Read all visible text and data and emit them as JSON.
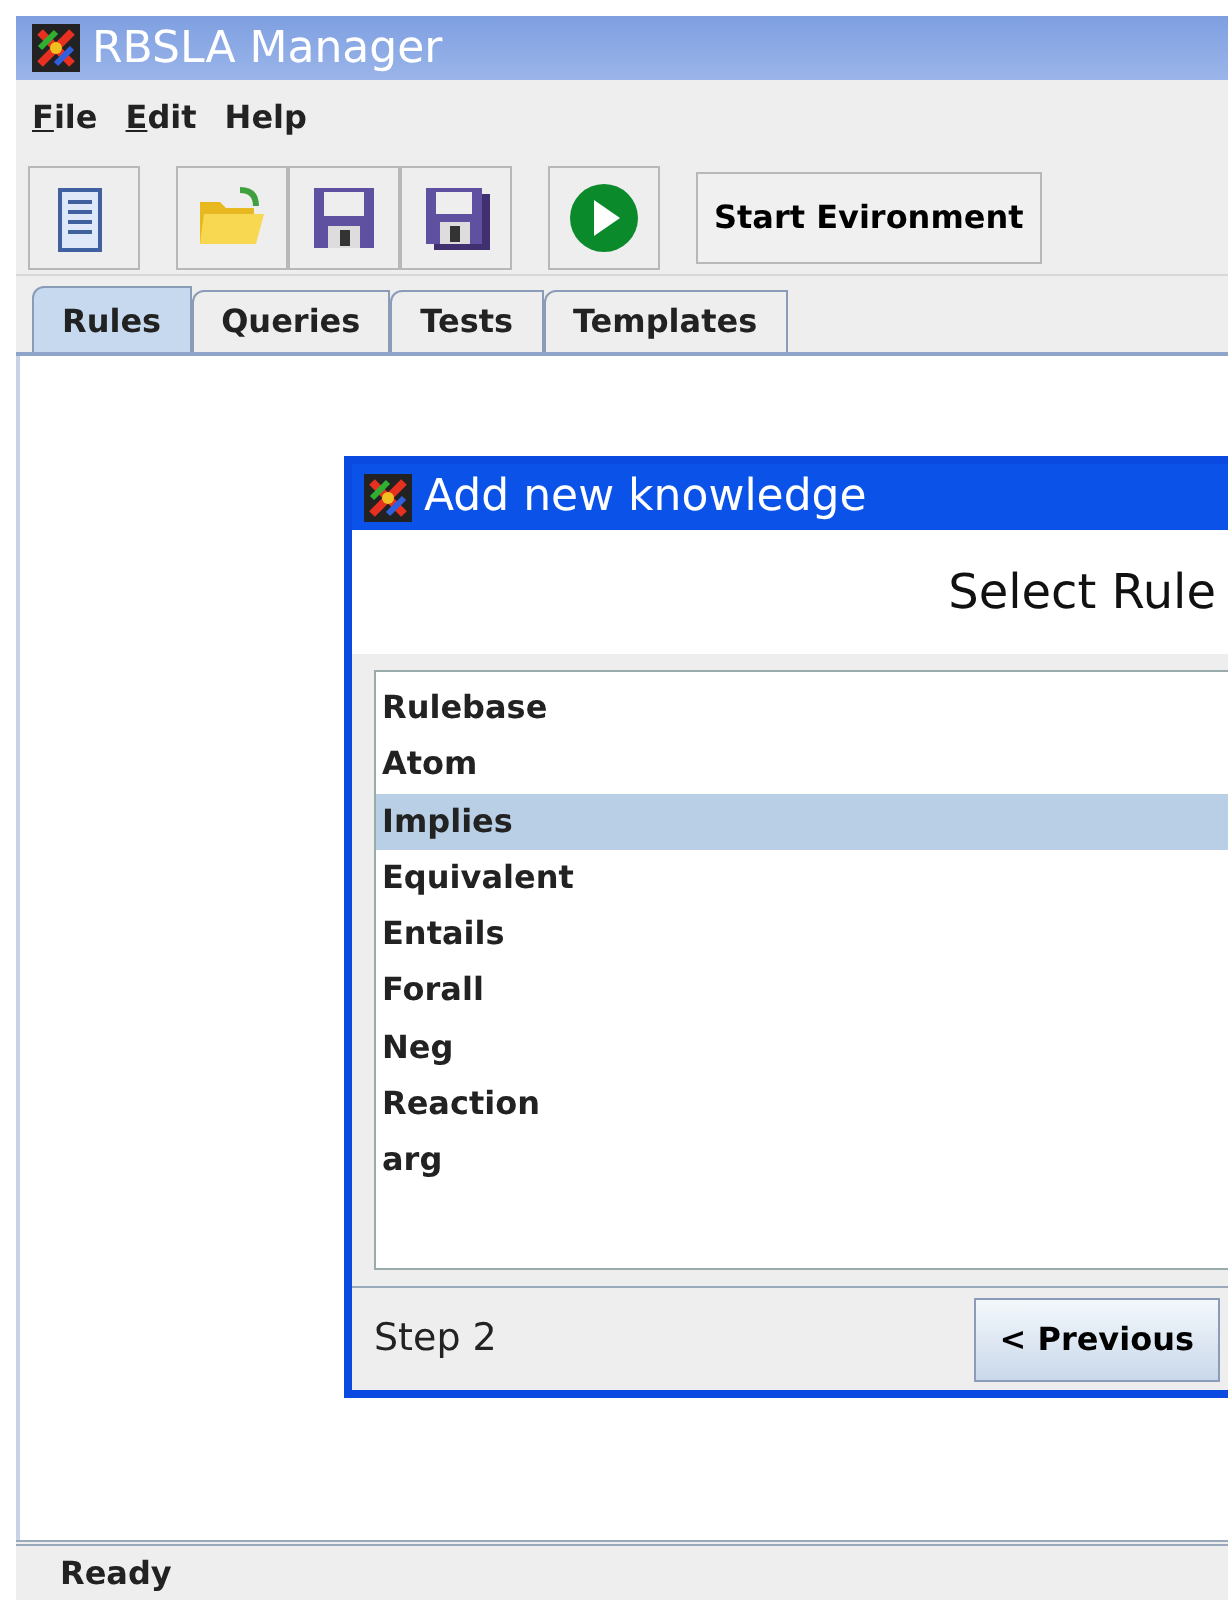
{
  "window": {
    "title": "RBSLA Manager"
  },
  "menu": [
    {
      "label": "File",
      "mnemonic": true
    },
    {
      "label": "Edit",
      "mnemonic": true
    },
    {
      "label": "Help",
      "mnemonic": false
    }
  ],
  "toolbar": {
    "buttons": [
      {
        "kind": "new"
      },
      {
        "kind": "open"
      },
      {
        "kind": "save"
      },
      {
        "kind": "saveas"
      },
      {
        "kind": "run"
      }
    ],
    "action": "Start Evironment"
  },
  "tabs": [
    {
      "label": "Rules",
      "selected": true
    },
    {
      "label": "Queries",
      "selected": false
    },
    {
      "label": "Tests",
      "selected": false
    },
    {
      "label": "Templates",
      "selected": false
    }
  ],
  "dialog": {
    "title": "Add new knowledge",
    "heading": "Select Rule",
    "items": [
      {
        "label": "Rulebase",
        "selected": false
      },
      {
        "label": "Atom",
        "selected": false
      },
      {
        "label": "Implies",
        "selected": true
      },
      {
        "label": "Equivalent",
        "selected": false
      },
      {
        "label": "Entails",
        "selected": false
      },
      {
        "label": "Forall",
        "selected": false
      },
      {
        "label": "Neg",
        "selected": false
      },
      {
        "label": "Reaction",
        "selected": false
      },
      {
        "label": "arg",
        "selected": false
      }
    ],
    "step": "Step 2",
    "previous": "< Previous"
  },
  "status_bar": "Ready"
}
